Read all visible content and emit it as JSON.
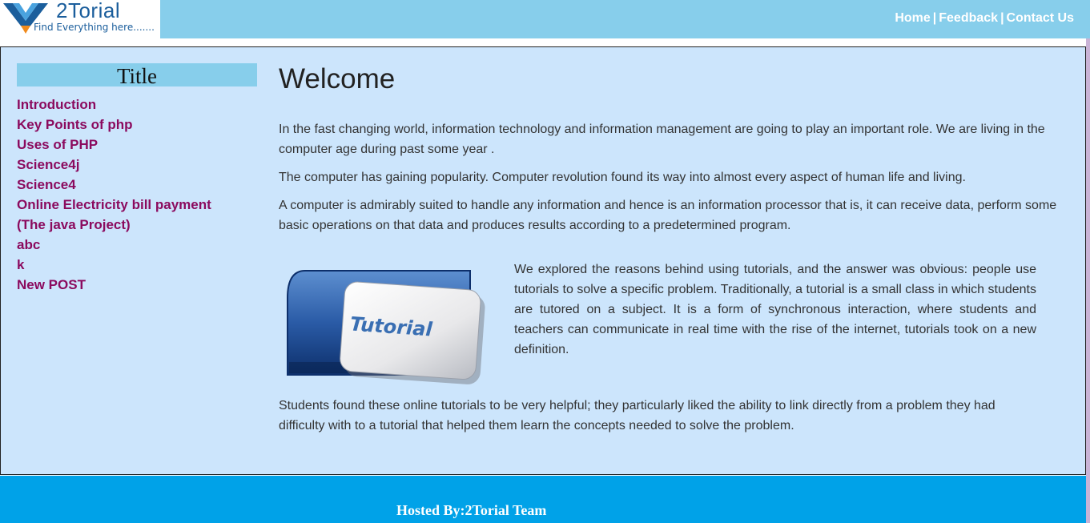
{
  "brand": {
    "name": "2Torial",
    "tagline": "Find Everything here......."
  },
  "nav": {
    "home": "Home",
    "feedback": "Feedback",
    "contact": "Contact Us",
    "separator": "|"
  },
  "sidebar": {
    "title": "Title",
    "items": [
      {
        "label": "Introduction"
      },
      {
        "label": "Key Points of php"
      },
      {
        "label": "Uses of PHP"
      },
      {
        "label": "Science4j"
      },
      {
        "label": "Science4"
      },
      {
        "label": "Online Electricity bill payment"
      },
      {
        "label": "(The java Project)"
      },
      {
        "label": "abc"
      },
      {
        "label": "k"
      },
      {
        "label": "New POST"
      }
    ]
  },
  "content": {
    "heading": "Welcome",
    "paragraph1": "In the fast changing world, information technology and information management are going to play an important role. We are living in the computer age during past some year .",
    "paragraph2": "The computer has gaining popularity. Computer revolution found its way into almost every aspect of human life and living.",
    "paragraph3": "A computer is admirably suited to handle any information and hence is an information processor that is, it can receive data, perform some basic operations on that data and produces results according to a predetermined program.",
    "tutorial_image_label": "Tutorial",
    "paragraph4": "We explored the reasons behind using tutorials, and the answer was obvious: people use tutorials to solve a specific problem. Traditionally, a tutorial is a small class in which students are tutored on a subject. It is a form of synchronous interaction, where students and teachers can communicate in real time with the rise of the internet, tutorials took on a new definition.",
    "paragraph5": "Students found these online tutorials to be very helpful; they particularly liked the ability to link directly from a problem they had difficulty with to a tutorial that helped them learn the concepts needed to solve the problem."
  },
  "footer": {
    "text": "Hosted By:2Torial Team"
  },
  "colors": {
    "header_bg": "#87CEEB",
    "main_bg": "#CCE5FC",
    "sidebar_link": "#8B0A5E",
    "footer_bg": "#00A2E8"
  }
}
